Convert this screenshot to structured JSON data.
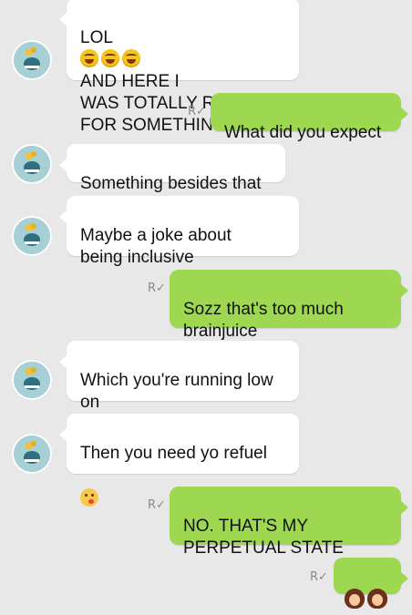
{
  "messages": [
    {
      "side": "in",
      "text_prefix": "LOL",
      "text_suffix": "AND HERE I\nWAS TOTALLY READY\nFOR SOMETHING ELSE",
      "emojis": [
        "grinning-sweat-emoji",
        "grinning-sweat-emoji",
        "grinning-sweat-emoji"
      ]
    },
    {
      "side": "out",
      "text": "What did you expect",
      "status": "R✓"
    },
    {
      "side": "in",
      "text": "Something besides that"
    },
    {
      "side": "in",
      "text": "Maybe a joke about\nbeing inclusive"
    },
    {
      "side": "out",
      "text": "Sozz that's too much\nbrainjuice",
      "status": "R✓"
    },
    {
      "side": "in",
      "text": "Which you're running low\non"
    },
    {
      "side": "in",
      "text": "Then you need yo refuel",
      "emoji": "kiss-emoji"
    },
    {
      "side": "out",
      "text": "NO. THAT'S MY\nPERPETUAL STATE",
      "status": "R✓"
    },
    {
      "side": "out",
      "emoji": "girls-emoji",
      "status": "R✓"
    }
  ],
  "colors": {
    "background": "#e8e8e8",
    "incoming_bubble": "#ffffff",
    "outgoing_bubble": "#9ed850",
    "avatar_bg": "#a7cfd6"
  }
}
